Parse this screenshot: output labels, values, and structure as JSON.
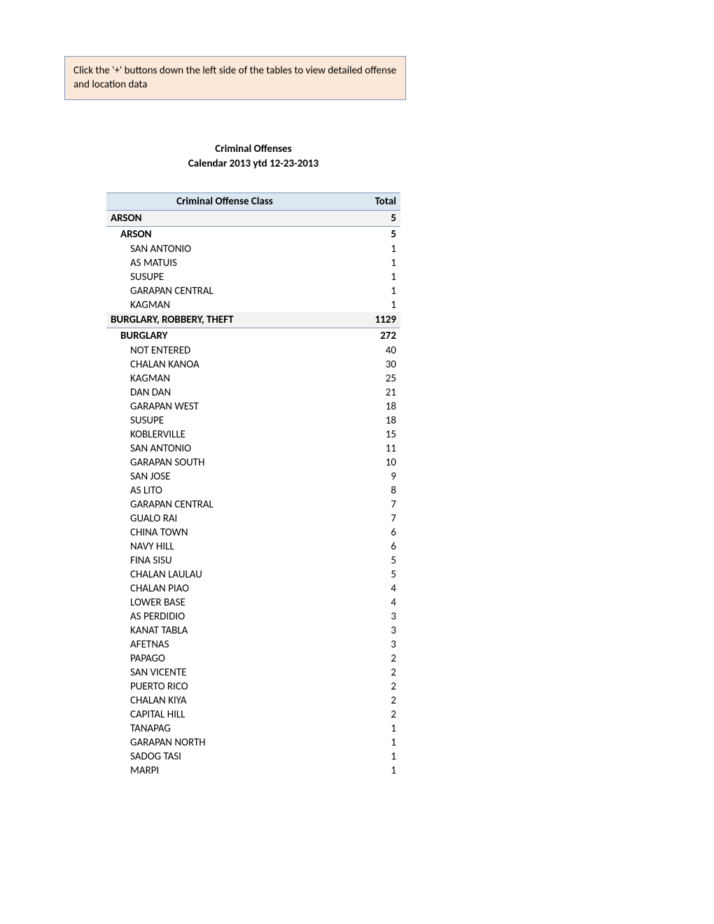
{
  "notice": "Click the '+' buttons down the left side of the tables to view detailed offense and location data",
  "title_line1": "Criminal Offenses",
  "title_line2": "Calendar 2013 ytd 12-23-2013",
  "columns": {
    "class": "Criminal Offense Class",
    "total": "Total"
  },
  "rows": [
    {
      "level": 1,
      "label": "ARSON",
      "total": 5
    },
    {
      "level": 2,
      "label": "ARSON",
      "total": 5
    },
    {
      "level": 3,
      "label": "SAN ANTONIO",
      "total": 1
    },
    {
      "level": 3,
      "label": "AS MATUIS",
      "total": 1
    },
    {
      "level": 3,
      "label": "SUSUPE",
      "total": 1
    },
    {
      "level": 3,
      "label": "GARAPAN CENTRAL",
      "total": 1
    },
    {
      "level": 3,
      "label": "KAGMAN",
      "total": 1
    },
    {
      "level": 1,
      "label": "BURGLARY, ROBBERY, THEFT",
      "total": 1129
    },
    {
      "level": 2,
      "label": "BURGLARY",
      "total": 272
    },
    {
      "level": 3,
      "label": "NOT ENTERED",
      "total": 40
    },
    {
      "level": 3,
      "label": "CHALAN KANOA",
      "total": 30
    },
    {
      "level": 3,
      "label": "KAGMAN",
      "total": 25
    },
    {
      "level": 3,
      "label": "DAN DAN",
      "total": 21
    },
    {
      "level": 3,
      "label": "GARAPAN WEST",
      "total": 18
    },
    {
      "level": 3,
      "label": "SUSUPE",
      "total": 18
    },
    {
      "level": 3,
      "label": "KOBLERVILLE",
      "total": 15
    },
    {
      "level": 3,
      "label": "SAN ANTONIO",
      "total": 11
    },
    {
      "level": 3,
      "label": "GARAPAN SOUTH",
      "total": 10
    },
    {
      "level": 3,
      "label": "SAN JOSE",
      "total": 9
    },
    {
      "level": 3,
      "label": "AS LITO",
      "total": 8
    },
    {
      "level": 3,
      "label": "GARAPAN CENTRAL",
      "total": 7
    },
    {
      "level": 3,
      "label": "GUALO RAI",
      "total": 7
    },
    {
      "level": 3,
      "label": "CHINA TOWN",
      "total": 6
    },
    {
      "level": 3,
      "label": "NAVY HILL",
      "total": 6
    },
    {
      "level": 3,
      "label": "FINA SISU",
      "total": 5
    },
    {
      "level": 3,
      "label": "CHALAN LAULAU",
      "total": 5
    },
    {
      "level": 3,
      "label": "CHALAN PIAO",
      "total": 4
    },
    {
      "level": 3,
      "label": "LOWER BASE",
      "total": 4
    },
    {
      "level": 3,
      "label": "AS PERDIDIO",
      "total": 3
    },
    {
      "level": 3,
      "label": "KANAT TABLA",
      "total": 3
    },
    {
      "level": 3,
      "label": "AFETNAS",
      "total": 3
    },
    {
      "level": 3,
      "label": "PAPAGO",
      "total": 2
    },
    {
      "level": 3,
      "label": "SAN VICENTE",
      "total": 2
    },
    {
      "level": 3,
      "label": "PUERTO RICO",
      "total": 2
    },
    {
      "level": 3,
      "label": "CHALAN KIYA",
      "total": 2
    },
    {
      "level": 3,
      "label": "CAPITAL HILL",
      "total": 2
    },
    {
      "level": 3,
      "label": "TANAPAG",
      "total": 1
    },
    {
      "level": 3,
      "label": "GARAPAN NORTH",
      "total": 1
    },
    {
      "level": 3,
      "label": "SADOG TASI",
      "total": 1
    },
    {
      "level": 3,
      "label": "MARPI",
      "total": 1
    }
  ]
}
